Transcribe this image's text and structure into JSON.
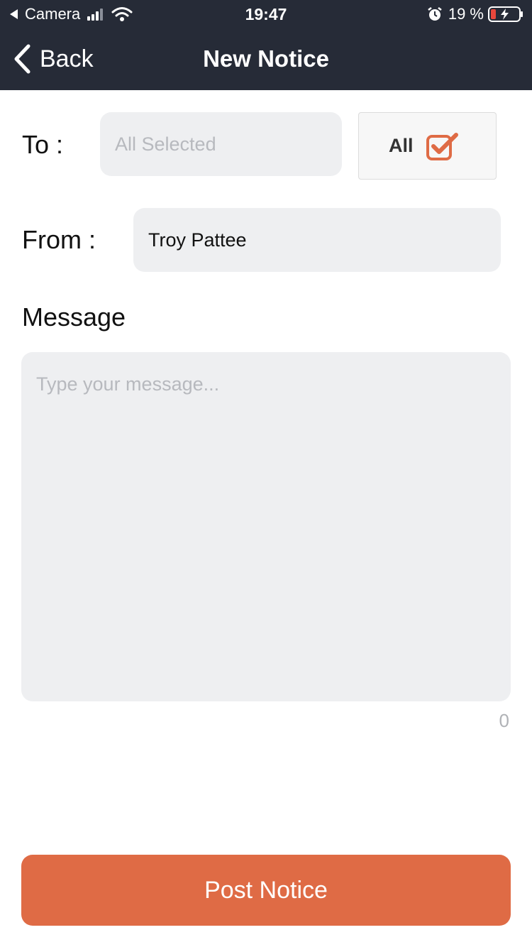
{
  "status_bar": {
    "back_app": "Camera",
    "time": "19:47",
    "battery_percent": "19 %",
    "battery_level": 0.19,
    "signal_bars": 3,
    "signal_bars_total": 4
  },
  "nav": {
    "back_label": "Back",
    "title": "New Notice"
  },
  "form": {
    "to": {
      "label": "To :",
      "placeholder": "All Selected"
    },
    "all_toggle": {
      "label": "All",
      "checked": true
    },
    "from": {
      "label": "From :",
      "value": "Troy Pattee"
    },
    "message": {
      "label": "Message",
      "placeholder": "Type your message...",
      "char_count": "0"
    }
  },
  "submit": {
    "label": "Post Notice"
  },
  "colors": {
    "header_bg": "#262b37",
    "accent": "#df6b45",
    "field_bg": "#eeeff1",
    "placeholder": "#b7b9be",
    "battery_low": "#e8473c"
  },
  "icons": {
    "back": "chevron-left-icon",
    "check": "checkbox-checked-icon",
    "wifi": "wifi-icon",
    "alarm": "alarm-icon",
    "battery": "battery-charging-icon"
  }
}
